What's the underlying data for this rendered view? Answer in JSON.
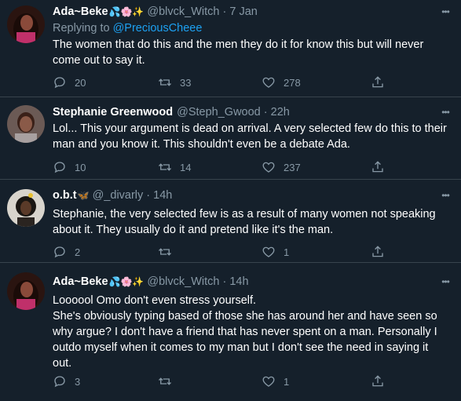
{
  "colors": {
    "background": "#15202b",
    "divider": "#38444d",
    "muted": "#8899a6",
    "link": "#1da1f2",
    "text": "#ffffff"
  },
  "tweets": [
    {
      "name": "Ada~Beke",
      "emoji": "💦🌸✨",
      "handle": "@blvck_Witch",
      "time": "7 Jan",
      "replying_prefix": "Replying to",
      "replying_to": "@PreciousCheee",
      "body": "The women that do this and the men they do it for know this but will never come out to say it.",
      "replies": "20",
      "retweets": "33",
      "likes": "278"
    },
    {
      "name": "Stephanie Greenwood",
      "emoji": "",
      "handle": "@Steph_Gwood",
      "time": "22h",
      "body": "Lol... This your argument is dead on arrival. A very selected few do this to their man and you know it. This shouldn't even be a debate Ada.",
      "replies": "10",
      "retweets": "14",
      "likes": "237"
    },
    {
      "name": "o.b.t",
      "emoji": "🦋",
      "handle": "@_divarly",
      "time": "14h",
      "body": "Stephanie, the very selected few is as a result of many women not speaking about it. They usually do it and pretend like it's the man.",
      "replies": "2",
      "retweets": "",
      "likes": "1"
    },
    {
      "name": "Ada~Beke",
      "emoji": "💦🌸✨",
      "handle": "@blvck_Witch",
      "time": "14h",
      "body_lines": [
        "Loooool Omo don't even stress yourself.",
        "She's obviously typing based of those she has around her and have seen so why argue? I don't have a friend that has never spent on a man. Personally I outdo myself when it comes to my man but I don't see the need in saying it out."
      ],
      "replies": "3",
      "retweets": "",
      "likes": "1"
    }
  ]
}
